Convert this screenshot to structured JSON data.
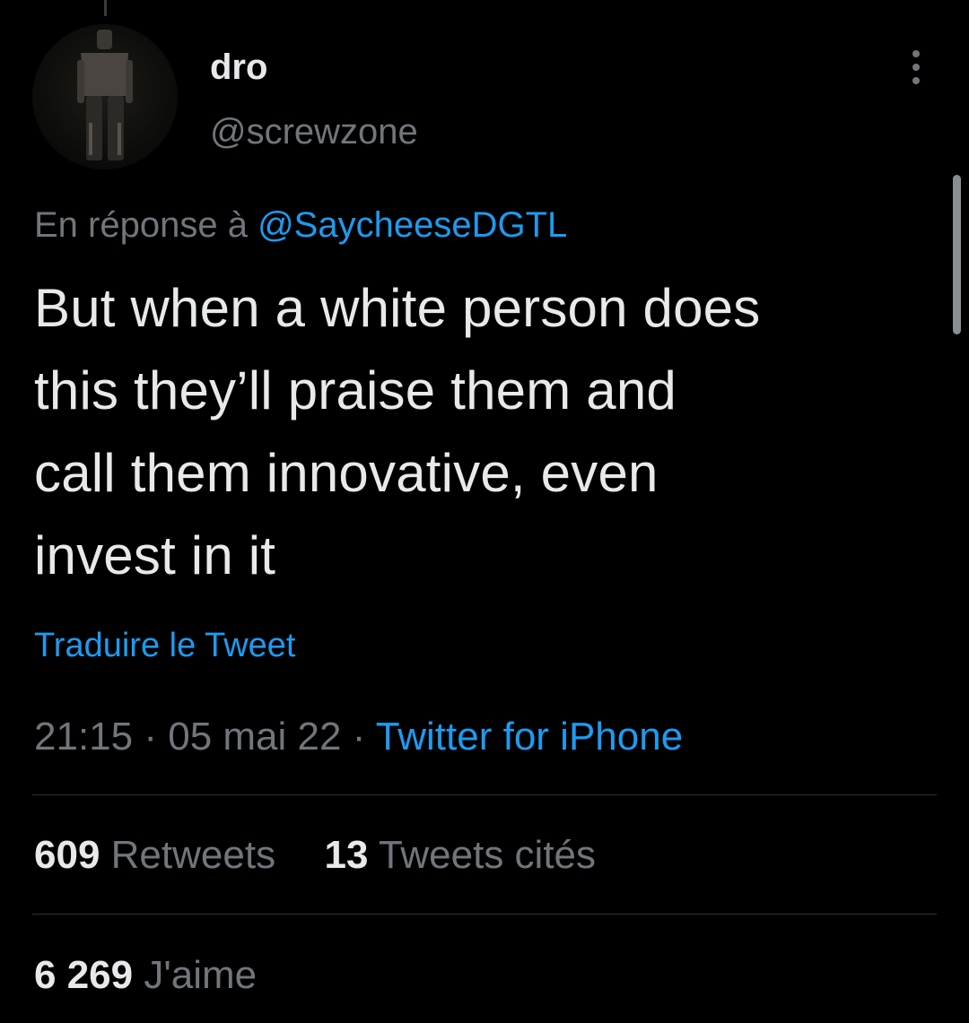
{
  "tweet": {
    "author": {
      "display_name": "dro",
      "handle": "@screwzone"
    },
    "reply_context": {
      "prefix": "En réponse à",
      "mention": "@SaycheeseDGTL"
    },
    "text_lines": [
      "But when a white person does",
      "this they’ll praise them and",
      "call them innovative, even",
      "invest in it"
    ],
    "translate_label": "Traduire le Tweet",
    "meta": {
      "time": "21:15",
      "separator": "·",
      "date": "05 mai 22",
      "source": "Twitter for iPhone"
    },
    "stats": {
      "retweets_count": "609",
      "retweets_label": "Retweets",
      "quotes_count": "13",
      "quotes_label": "Tweets cités",
      "likes_count": "6 269",
      "likes_label": "J'aime"
    }
  },
  "colors": {
    "background": "#000000",
    "primary_text": "#e7e9ea",
    "secondary_text": "#71767b",
    "link": "#1d9bf0",
    "divider": "#2f3336"
  },
  "icons": {
    "more": "more-vertical-icon"
  }
}
